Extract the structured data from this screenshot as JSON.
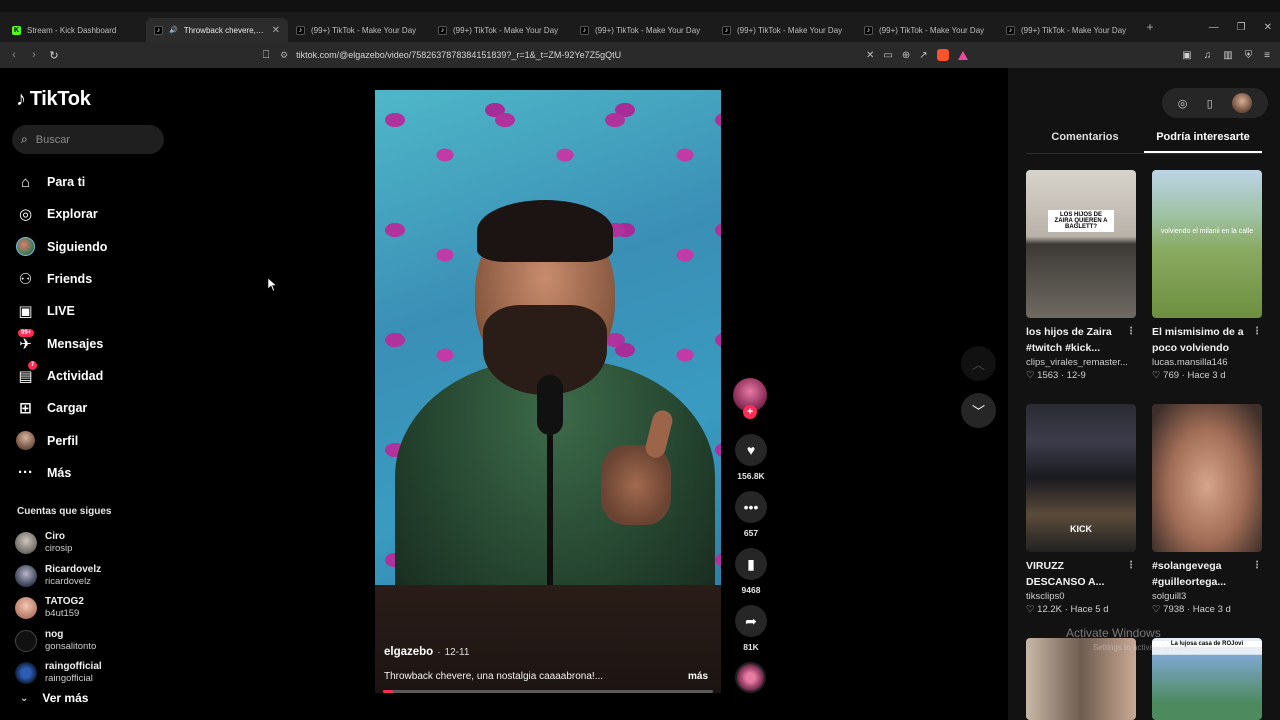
{
  "browser": {
    "tabs": [
      {
        "title": "Stream - Kick Dashboard",
        "favicon": "kick",
        "active": false
      },
      {
        "title": "Throwback chevere, un",
        "favicon": "tiktok",
        "active": true
      },
      {
        "title": "(99+) TikTok - Make Your Day",
        "favicon": "tiktok",
        "active": false
      },
      {
        "title": "(99+) TikTok - Make Your Day",
        "favicon": "tiktok",
        "active": false
      },
      {
        "title": "(99+) TikTok - Make Your Day",
        "favicon": "tiktok",
        "active": false
      },
      {
        "title": "(99+) TikTok - Make Your Day",
        "favicon": "tiktok",
        "active": false
      },
      {
        "title": "(99+) TikTok - Make Your Day",
        "favicon": "tiktok",
        "active": false
      },
      {
        "title": "(99+) TikTok - Make Your Day",
        "favicon": "tiktok",
        "active": false
      }
    ],
    "url": "tiktok.com/@elgazebo/video/7582637878384151839?_r=1&_t=ZM-92Ye7Z5gQtU"
  },
  "sidebar": {
    "logo": "TikTok",
    "search_placeholder": "Buscar",
    "nav": [
      {
        "label": "Para ti",
        "icon": "home-icon"
      },
      {
        "label": "Explorar",
        "icon": "compass-icon"
      },
      {
        "label": "Siguiendo",
        "icon": "following-avatar-icon"
      },
      {
        "label": "Friends",
        "icon": "friends-icon"
      },
      {
        "label": "LIVE",
        "icon": "live-icon"
      },
      {
        "label": "Mensajes",
        "icon": "messages-icon",
        "badge": "99+"
      },
      {
        "label": "Actividad",
        "icon": "activity-icon",
        "badge": "7"
      },
      {
        "label": "Cargar",
        "icon": "upload-icon"
      },
      {
        "label": "Perfil",
        "icon": "profile-avatar-icon"
      },
      {
        "label": "Más",
        "icon": "more-icon"
      }
    ],
    "following_title": "Cuentas que sigues",
    "following": [
      {
        "name": "Ciro",
        "handle": "cirosip"
      },
      {
        "name": "Ricardovelz",
        "handle": "ricardovelz"
      },
      {
        "name": "TATOG2",
        "handle": "b4ut159"
      },
      {
        "name": "nog",
        "handle": "gonsalitonto"
      },
      {
        "name": "raingofficial",
        "handle": "raingofficial"
      }
    ],
    "see_more": "Ver más"
  },
  "video": {
    "author": "elgazebo",
    "date": "12-11",
    "caption": "Throwback chevere, una nostalgia caaaabrona!...",
    "more_label": "más",
    "progress": 0.03,
    "likes": "156.8K",
    "comments": "657",
    "saves": "9468",
    "shares": "81K"
  },
  "right_panel": {
    "tabs": [
      {
        "label": "Comentarios",
        "active": false
      },
      {
        "label": "Podría interesarte",
        "active": true
      }
    ],
    "cards": [
      {
        "desc": "los hijos de Zaira #twitch #kick...",
        "author": "clips_virales_remaster...",
        "likes": "1563",
        "time": "12-9",
        "thumb_text": "LOS HIJOS DE ZAIRA QUIEREN A BAGLETT?"
      },
      {
        "desc": "El mismisimo de a poco volviendo",
        "author": "lucas.mansilla146",
        "likes": "769",
        "time": "Hace 3 d",
        "thumb_text": "volviendo el milanii en la calle"
      },
      {
        "desc": "VIRUZZ DESCANSO A...",
        "author": "tiksclips0",
        "likes": "12.2K",
        "time": "Hace 5 d",
        "thumb_text": "KICK"
      },
      {
        "desc": "#solangevega #guilleortega...",
        "author": "solguill3",
        "likes": "7938",
        "time": "Hace 3 d",
        "thumb_text": ""
      },
      {
        "desc": "",
        "author": "",
        "likes": "",
        "time": "",
        "thumb_text": ""
      },
      {
        "desc": "",
        "author": "",
        "likes": "",
        "time": "",
        "thumb_text": "La lujosa casa de ROJovi"
      }
    ]
  },
  "watermark": {
    "line1": "Activate Windows",
    "line2": "Settings to activate Windows."
  }
}
